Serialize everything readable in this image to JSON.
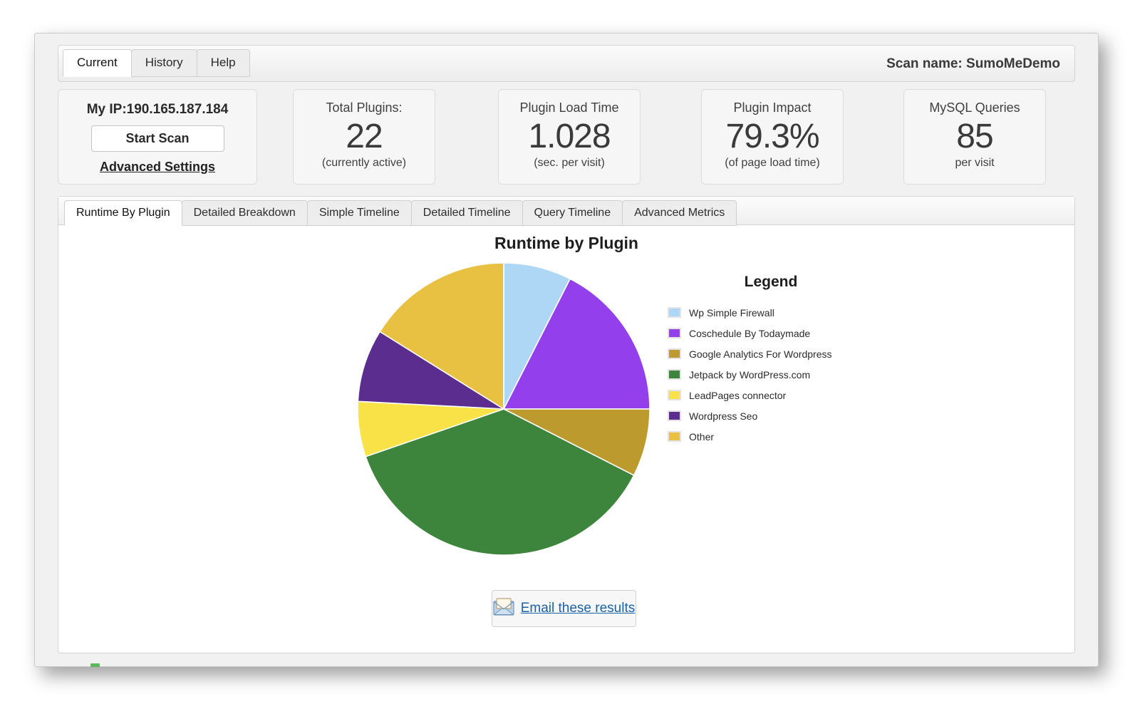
{
  "header": {
    "tabs": [
      {
        "label": "Current",
        "active": true
      },
      {
        "label": "History",
        "active": false
      },
      {
        "label": "Help",
        "active": false
      }
    ],
    "scan_name": "Scan name: SumoMeDemo"
  },
  "ip_card": {
    "ip_text": "My IP:190.165.187.184",
    "start_scan_label": "Start Scan",
    "advanced_settings_label": "Advanced Settings"
  },
  "stats": [
    {
      "label": "Total Plugins:",
      "value": "22",
      "sub": "(currently active)"
    },
    {
      "label": "Plugin Load Time",
      "value": "1.028",
      "sub": "(sec. per visit)"
    },
    {
      "label": "Plugin Impact",
      "value": "79.3%",
      "sub": "(of page load time)"
    },
    {
      "label": "MySQL Queries",
      "value": "85",
      "sub": "per visit"
    }
  ],
  "panel": {
    "tabs": [
      {
        "label": "Runtime By Plugin",
        "active": true
      },
      {
        "label": "Detailed Breakdown",
        "active": false
      },
      {
        "label": "Simple Timeline",
        "active": false
      },
      {
        "label": "Detailed Timeline",
        "active": false
      },
      {
        "label": "Query Timeline",
        "active": false
      },
      {
        "label": "Advanced Metrics",
        "active": false
      }
    ],
    "legend_title": "Legend",
    "email_button_label": "Email these results",
    "email_icon": "envelope-icon"
  },
  "chart_data": {
    "type": "pie",
    "title": "Runtime by Plugin",
    "legend_position": "right",
    "start_angle_deg": 0,
    "direction": "clockwise",
    "categories": [
      "Wp Simple Firewall",
      "Coschedule By Todaymade",
      "Google Analytics For Wordpress",
      "Jetpack by WordPress.com",
      "LeadPages connector",
      "Wordpress Seo",
      "Other"
    ],
    "values": [
      7.5,
      17.5,
      7.5,
      37.2,
      6.1,
      8.1,
      16.1
    ],
    "angles_deg": [
      27,
      63,
      27,
      134,
      22,
      29,
      58
    ],
    "colors": [
      "#aed6f5",
      "#9340ec",
      "#bc9a2e",
      "#3d853c",
      "#f8e247",
      "#5b2d8e",
      "#e8c143"
    ]
  }
}
